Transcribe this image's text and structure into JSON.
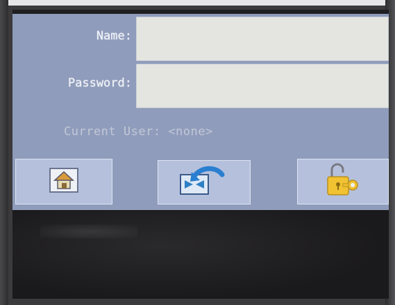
{
  "login": {
    "name_label": "Name:",
    "password_label": "Password:",
    "name_value": "",
    "password_value": "",
    "current_user_label": "Current User:",
    "current_user_value": "<none>"
  },
  "buttons": {
    "home_icon": "home-icon",
    "exit_icon": "exit-return-icon",
    "lock_icon": "padlock-key-icon"
  },
  "colors": {
    "panel": "#8f9cbb",
    "field": "#e4e5e0",
    "button": "#b5c1dc"
  }
}
